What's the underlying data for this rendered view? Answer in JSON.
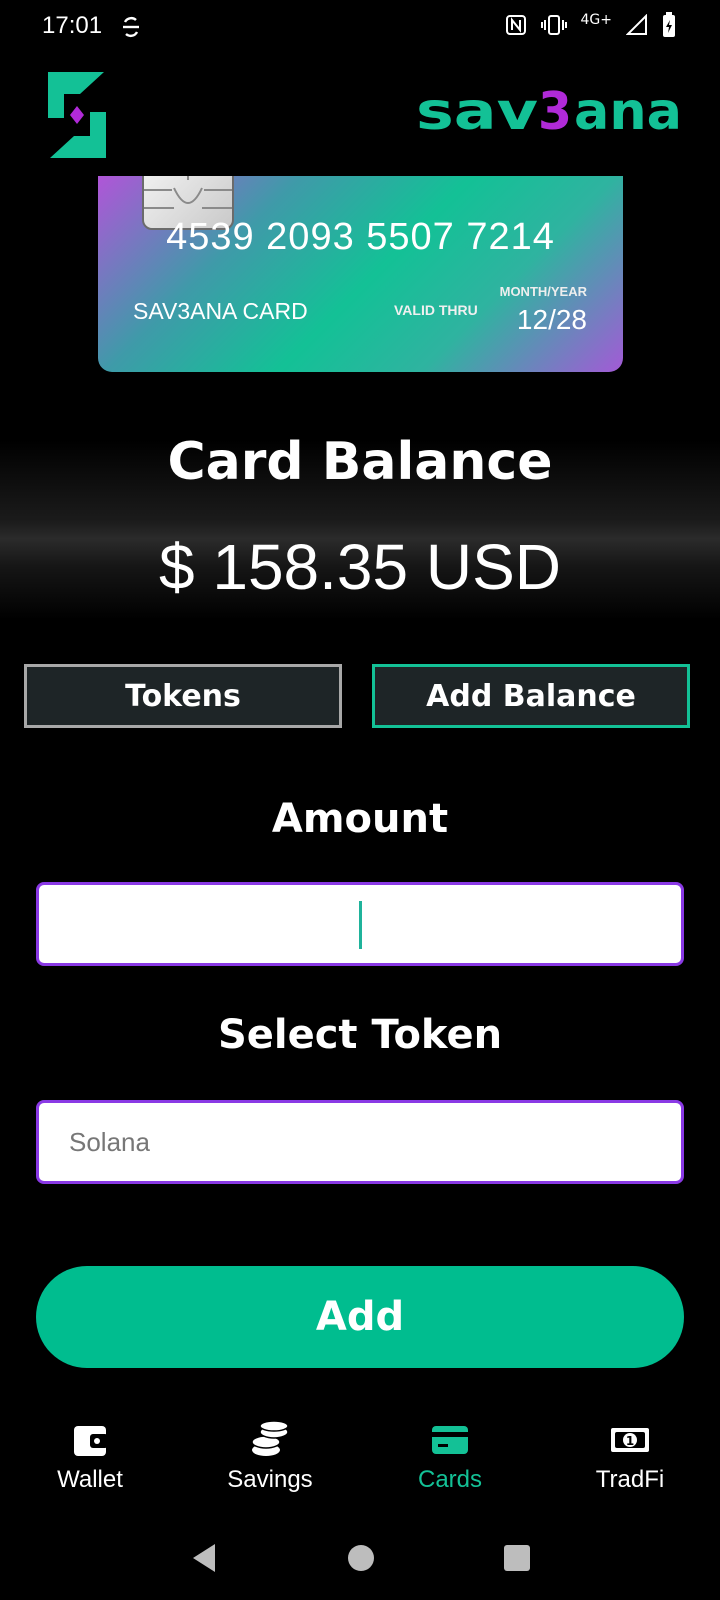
{
  "status_bar": {
    "time": "17:01",
    "network": "4G+"
  },
  "brand": {
    "name": "SAV3ANA",
    "colors": {
      "primary": "#13c196",
      "accent": "#b02ad8"
    }
  },
  "card": {
    "number": "4539 2093 5507 7214",
    "name": "SAV3ANA CARD",
    "valid_thru_label": "VALID THRU",
    "month_year_label": "MONTH/YEAR",
    "expiry": "12/28"
  },
  "balance": {
    "title": "Card Balance",
    "value": "$ 158.35 USD"
  },
  "tabs": {
    "tokens": "Tokens",
    "add_balance": "Add Balance",
    "active": "add_balance"
  },
  "form": {
    "amount_label": "Amount",
    "amount_value": "",
    "token_label": "Select Token",
    "token_value": "Solana",
    "submit": "Add"
  },
  "bottom_nav": [
    {
      "label": "Wallet",
      "icon": "wallet-icon"
    },
    {
      "label": "Savings",
      "icon": "coins-icon"
    },
    {
      "label": "Cards",
      "icon": "card-icon",
      "active": true
    },
    {
      "label": "TradFi",
      "icon": "banknote-icon"
    }
  ]
}
